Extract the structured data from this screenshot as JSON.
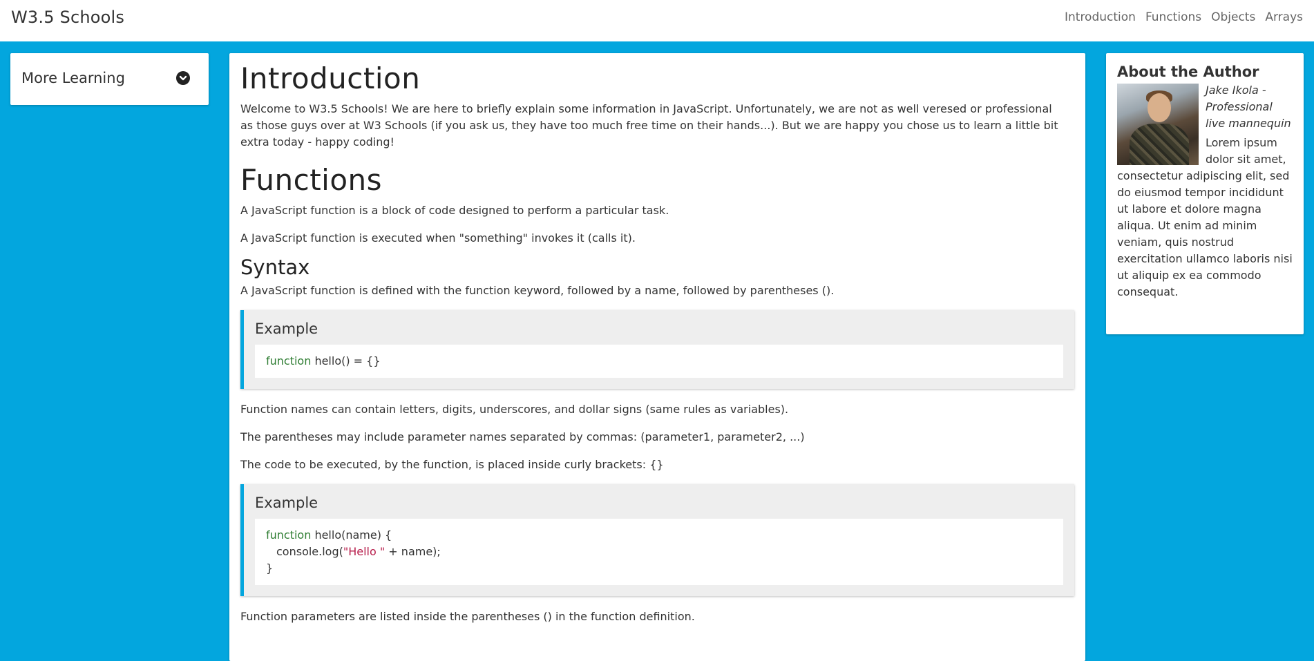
{
  "navbar": {
    "brand": "W3.5 Schools",
    "links": [
      "Introduction",
      "Functions",
      "Objects",
      "Arrays"
    ]
  },
  "sidebar": {
    "title": "More Learning",
    "toggle_icon": "chevron-down-circle-icon"
  },
  "main": {
    "intro_heading": "Introduction",
    "intro_text": "Welcome to W3.5 Schools! We are here to briefly explain some information in JavaScript. Unfortunately, we are not as well veresed or professional as those guys over at W3 Schools (if you ask us, they have too much free time on their hands...). But we are happy you chose us to learn a little bit extra today - happy coding!",
    "functions_heading": "Functions",
    "functions_p1": "A JavaScript function is a block of code designed to perform a particular task.",
    "functions_p2": "A JavaScript function is executed when \"something\" invokes it (calls it).",
    "syntax_heading": "Syntax",
    "syntax_p1": "A JavaScript function is defined with the function keyword, followed by a name, followed by parentheses ().",
    "example1": {
      "title": "Example",
      "code_keyword": "function",
      "code_rest": " hello() = {}"
    },
    "p_names": "Function names can contain letters, digits, underscores, and dollar signs (same rules as variables).",
    "p_params": "The parentheses may include parameter names separated by commas: (parameter1, parameter2, ...)",
    "p_code": "The code to be executed, by the function, is placed inside curly brackets: {}",
    "example2": {
      "title": "Example",
      "line1_keyword": "function",
      "line1_rest": " hello(name) {",
      "line2_start": "console.log(",
      "line2_string": "\"Hello \"",
      "line2_end": " + name);",
      "line3": "}"
    },
    "p_parameters": "Function parameters are listed inside the parentheses () in the function definition."
  },
  "author": {
    "title": "About the Author",
    "photo_alt": "author-photo",
    "caption": "Jake Ikola - Professional live mannequin",
    "bio": "Lorem ipsum dolor sit amet, consectetur adipiscing elit, sed do eiusmod tempor incididunt ut labore et dolore magna aliqua. Ut enim ad minim veniam, quis nostrud exercitation ullamco laboris nisi ut aliquip ex ea commodo consequat."
  },
  "colors": {
    "background": "#03a6de",
    "keyword": "#2e7d32",
    "string": "#b71c4a"
  }
}
